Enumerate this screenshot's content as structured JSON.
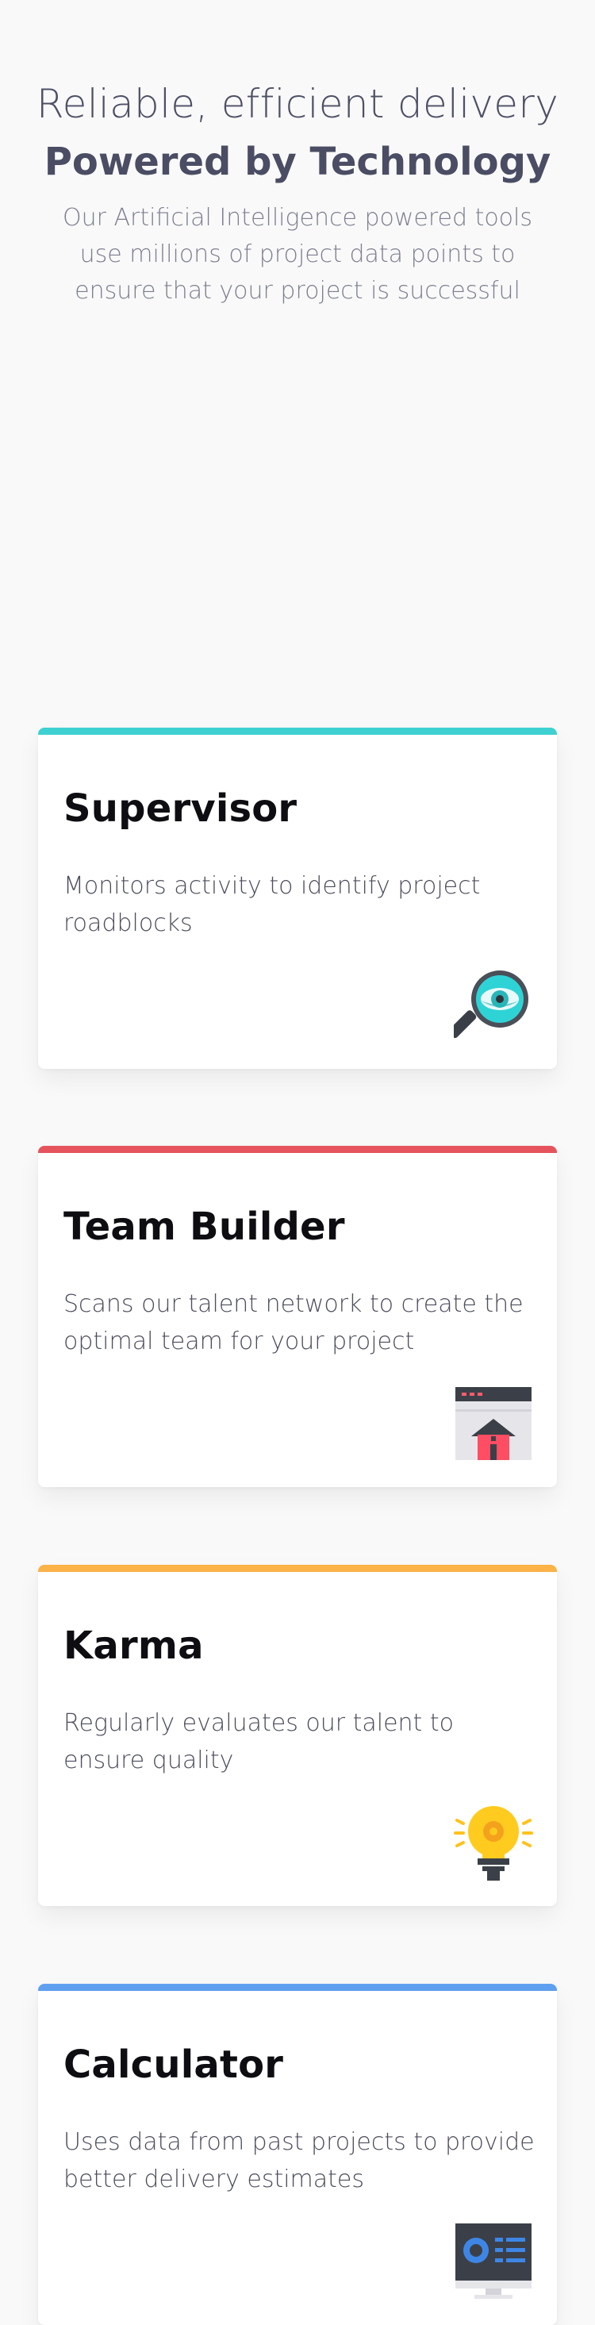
{
  "hero": {
    "line1": "Reliable, efficient delivery",
    "line2": "Powered by Technology",
    "subtitle": "Our Artificial Intelligence powered tools use millions of project data points to ensure that your project is successful"
  },
  "cards": [
    {
      "title": "Supervisor",
      "description": "Monitors activity to identify project roadblocks",
      "accent": "#3fd1d1",
      "icon": "magnifier-eye-icon"
    },
    {
      "title": "Team Builder",
      "description": "Scans our talent network to create the optimal team for your project",
      "accent": "#e5545c",
      "icon": "browser-home-icon"
    },
    {
      "title": "Karma",
      "description": "Regularly evaluates our talent to ensure quality",
      "accent": "#fbb247",
      "icon": "lightbulb-gear-icon"
    },
    {
      "title": "Calculator",
      "description": "Uses data from past projects to provide better delivery estimates",
      "accent": "#5ea0ef",
      "icon": "monitor-dashboard-icon"
    }
  ]
}
